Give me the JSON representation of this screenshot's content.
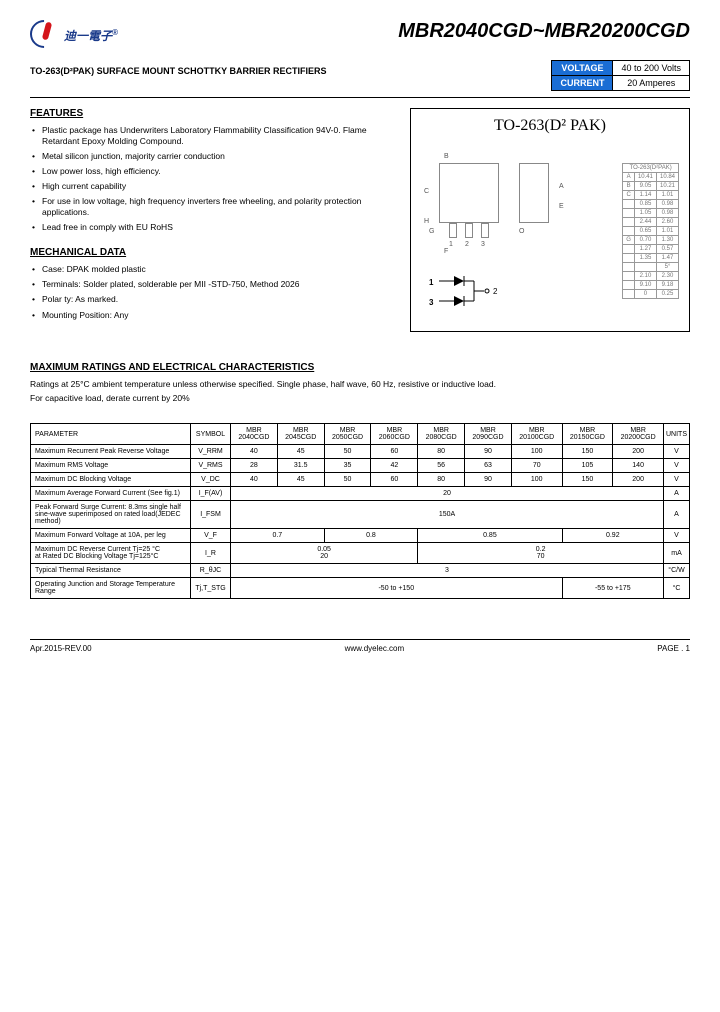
{
  "header": {
    "company": "迪一電子",
    "reg": "®",
    "part_title": "MBR2040CGD~MBR20200CGD"
  },
  "subtitle": "TO-263(D²PAK) SURFACE MOUNT SCHOTTKY BARRIER RECTIFIERS",
  "spec_box": {
    "voltage_label": "VOLTAGE",
    "current_label": "CURRENT",
    "voltage_value": "40 to 200 Volts",
    "current_value": "20 Amperes"
  },
  "features": {
    "heading": "FEATURES",
    "items": [
      "Plastic package has Underwriters Laboratory Flammability Classification 94V-0. Flame Retardant Epoxy Molding Compound.",
      "Metal silicon junction, majority carrier conduction",
      "Low power loss, high efficiency.",
      "High current capability",
      "For use in low voltage, high frequency inverters free wheeling, and polarity protection applications.",
      "Lead free in comply with EU RoHS"
    ]
  },
  "mechanical": {
    "heading": "MECHANICAL DATA",
    "items": [
      "Case: DPAK molded plastic",
      "Terminals: Solder plated, solderable per MII -STD-750, Method 2026",
      "Polar ty: As marked.",
      "Mounting Position: Any"
    ]
  },
  "package": {
    "title": "TO-263(D² PAK)",
    "dim_header": "TO-263(D²PAK)",
    "dims": [
      [
        "A",
        "10.41",
        "10.84"
      ],
      [
        "B",
        "9.05",
        "10.21"
      ],
      [
        "C",
        "1.14",
        "1.01"
      ],
      [
        "",
        "0.85",
        "0.98"
      ],
      [
        "",
        "1.05",
        "0.98"
      ],
      [
        "",
        "2.44",
        "2.60"
      ],
      [
        "",
        "0.65",
        "1.01"
      ],
      [
        "G",
        "0.70",
        "1.30"
      ],
      [
        "",
        "1.27",
        "0.57"
      ],
      [
        "",
        "1.35",
        "1.47"
      ],
      [
        "",
        "",
        "5°"
      ],
      [
        "",
        "2.10",
        "2.30"
      ],
      [
        "",
        "9.10",
        "9.18"
      ],
      [
        "",
        "0",
        "0.25"
      ]
    ],
    "pin1": "1",
    "pin3": "3",
    "pin2": "2"
  },
  "ratings": {
    "heading": "MAXIMUM RATINGS AND ELECTRICAL CHARACTERISTICS",
    "note1": "Ratings at 25°C ambient temperature unless otherwise specified. Single phase, half wave, 60 Hz, resistive or inductive load.",
    "note2": "For capacitive load, derate current by 20%"
  },
  "param_table": {
    "headers": [
      "PARAMETER",
      "SYMBOL",
      "MBR 2040CGD",
      "MBR 2045CGD",
      "MBR 2050CGD",
      "MBR 2060CGD",
      "MBR 2080CGD",
      "MBR 2090CGD",
      "MBR 20100CGD",
      "MBR 20150CGD",
      "MBR 20200CGD",
      "UNITS"
    ],
    "rows": [
      {
        "name": "Maximum Recurrent Peak Reverse Voltage",
        "sym": "V_RRM",
        "vals": [
          "40",
          "45",
          "50",
          "60",
          "80",
          "90",
          "100",
          "150",
          "200"
        ],
        "unit": "V"
      },
      {
        "name": "Maximum RMS Voltage",
        "sym": "V_RMS",
        "vals": [
          "28",
          "31.5",
          "35",
          "42",
          "56",
          "63",
          "70",
          "105",
          "140"
        ],
        "unit": "V"
      },
      {
        "name": "Maximum DC Blocking Voltage",
        "sym": "V_DC",
        "vals": [
          "40",
          "45",
          "50",
          "60",
          "80",
          "90",
          "100",
          "150",
          "200"
        ],
        "unit": "V"
      },
      {
        "name": "Maximum Average Forward Current (See fig.1)",
        "sym": "I_F(AV)",
        "span": "20",
        "unit": "A"
      },
      {
        "name": "Peak Forward Surge Current: 8.3ms single half sine-wave superimposed on rated load(JEDEC method)",
        "sym": "I_FSM",
        "span": "150A",
        "unit": "A"
      },
      {
        "name": "Maximum Forward Voltage at 10A, per leg",
        "sym": "V_F",
        "groups": [
          "0.7",
          "0.8",
          "0.85",
          "0.92"
        ],
        "unit": "V"
      },
      {
        "name": "Maximum DC Reverse Current  Tj=25 °C\nat Rated DC Blocking Voltage Tj=125°C",
        "sym": "I_R",
        "groups2": [
          [
            "0.05",
            "20"
          ],
          [
            "0.2",
            "70"
          ]
        ],
        "unit": "mA"
      },
      {
        "name": "Typical Thermal Resistance",
        "sym": "R_θJC",
        "span": "3",
        "unit": "°C/W"
      },
      {
        "name": "Operating Junction and Storage Temperature Range",
        "sym": "Tj,T_STG",
        "groups": [
          "-50 to +150",
          "-55 to +175"
        ],
        "split": "7_2",
        "unit": "°C"
      }
    ]
  },
  "footer": {
    "rev": "Apr.2015-REV.00",
    "url": "www.dyelec.com",
    "page": "PAGE . 1"
  }
}
